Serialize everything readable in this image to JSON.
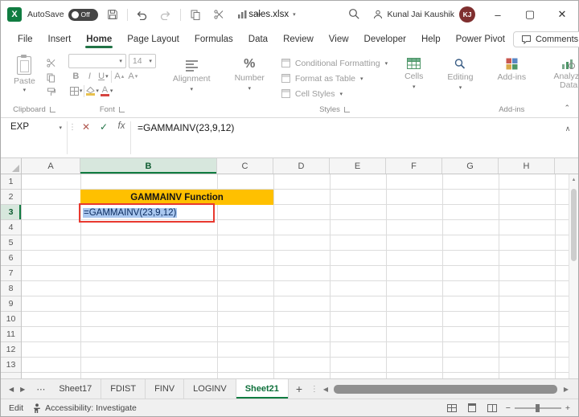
{
  "title_bar": {
    "autosave_label": "AutoSave",
    "autosave_state": "Off",
    "filename": "sales.xlsx",
    "user_name": "Kunal Jai Kaushik",
    "user_initials": "KJ"
  },
  "menu": {
    "tabs": [
      "File",
      "Insert",
      "Home",
      "Page Layout",
      "Formulas",
      "Data",
      "Review",
      "View",
      "Developer",
      "Help",
      "Power Pivot"
    ],
    "active_tab": "Home",
    "comments_label": "Comments"
  },
  "ribbon": {
    "paste": "Paste",
    "clipboard_group": "Clipboard",
    "font_group": "Font",
    "font_size": "14",
    "bold": "B",
    "italic": "I",
    "underline": "U",
    "alignment": "Alignment",
    "number": "Number",
    "number_symbol": "%",
    "conditional_formatting": "Conditional Formatting",
    "format_as_table": "Format as Table",
    "cell_styles": "Cell Styles",
    "styles_group": "Styles",
    "cells": "Cells",
    "editing": "Editing",
    "addins": "Add-ins",
    "addins_group": "Add-ins",
    "analyze_data": "Analyze Data"
  },
  "formula_bar": {
    "name_box": "EXP",
    "fx": "fx",
    "formula": "=GAMMAINV(23,9,12)"
  },
  "grid": {
    "columns": [
      "A",
      "B",
      "C",
      "D",
      "E",
      "F",
      "G",
      "H"
    ],
    "rows": [
      "1",
      "2",
      "3",
      "4",
      "5",
      "6",
      "7",
      "8",
      "9",
      "10",
      "11",
      "12",
      "13"
    ],
    "banner_text": "GAMMAINV Function",
    "b3_text": "=GAMMAINV(23,9,12)",
    "active_column": "B",
    "active_row": "3"
  },
  "sheet_bar": {
    "tabs": [
      "Sheet17",
      "FDIST",
      "FINV",
      "LOGINV",
      "Sheet21"
    ],
    "active_tab": "Sheet21"
  },
  "status_bar": {
    "mode": "Edit",
    "accessibility": "Accessibility: Investigate"
  },
  "colors": {
    "excel_green": "#107C41",
    "banner_yellow": "#FFC000",
    "selection_blue": "#A9C7EF",
    "annotation_red": "#E8392F",
    "avatar_maroon": "#7F2F2F"
  }
}
